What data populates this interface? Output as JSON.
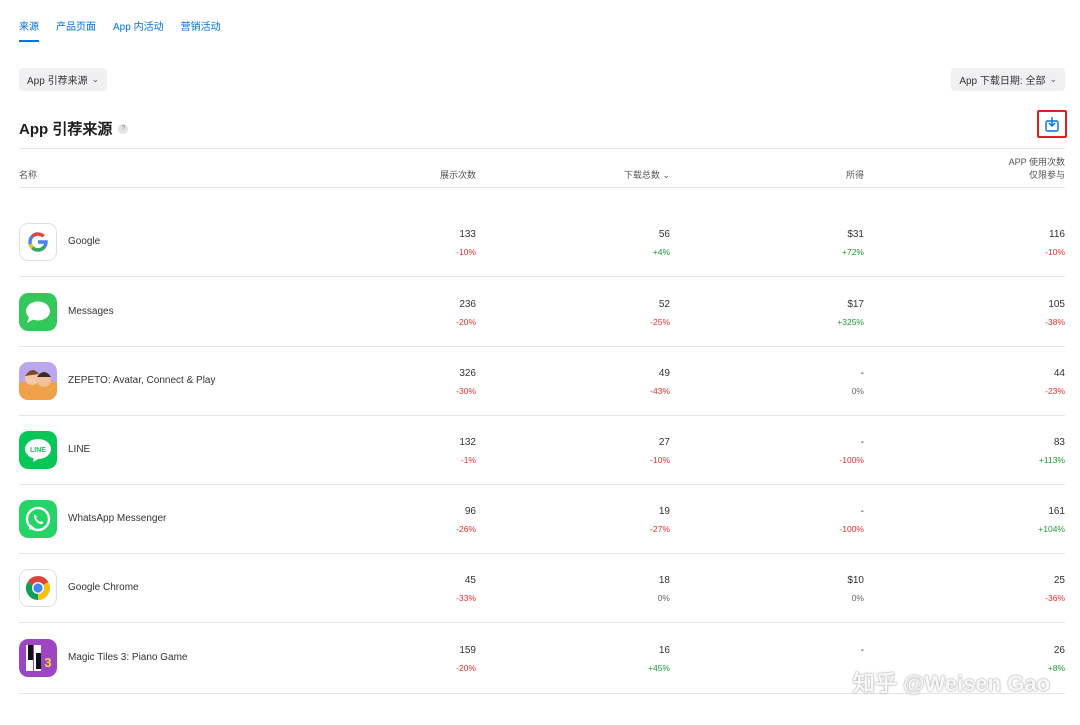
{
  "tabs": [
    "来源",
    "产品页面",
    "App 内活动",
    "营销活动"
  ],
  "filters": {
    "left_label": "App 引荐来源",
    "right_label": "App 下载日期: 全部"
  },
  "section": {
    "title": "App 引荐来源",
    "help": "?"
  },
  "table": {
    "headers": {
      "name": "名称",
      "impressions": "展示次数",
      "downloads": "下载总数",
      "proceeds": "所得",
      "usage_line1": "APP 使用次数",
      "usage_line2": "仅限参与"
    },
    "rows": [
      {
        "name": "Google",
        "icon": "google-icon",
        "impressions": "133",
        "impressions_delta": "-10%",
        "downloads": "56",
        "downloads_delta": "+4%",
        "proceeds": "$31",
        "proceeds_delta": "+72%",
        "usage": "116",
        "usage_delta": "-10%"
      },
      {
        "name": "Messages",
        "icon": "messages-icon",
        "impressions": "236",
        "impressions_delta": "-20%",
        "downloads": "52",
        "downloads_delta": "-25%",
        "proceeds": "$17",
        "proceeds_delta": "+325%",
        "usage": "105",
        "usage_delta": "-38%"
      },
      {
        "name": "ZEPETO: Avatar, Connect & Play",
        "icon": "zepeto-icon",
        "impressions": "326",
        "impressions_delta": "-30%",
        "downloads": "49",
        "downloads_delta": "-43%",
        "proceeds": "-",
        "proceeds_delta": "0%",
        "usage": "44",
        "usage_delta": "-23%"
      },
      {
        "name": "LINE",
        "icon": "line-icon",
        "impressions": "132",
        "impressions_delta": "-1%",
        "downloads": "27",
        "downloads_delta": "-10%",
        "proceeds": "-",
        "proceeds_delta": "-100%",
        "usage": "83",
        "usage_delta": "+113%"
      },
      {
        "name": "WhatsApp Messenger",
        "icon": "whatsapp-icon",
        "impressions": "96",
        "impressions_delta": "-26%",
        "downloads": "19",
        "downloads_delta": "-27%",
        "proceeds": "-",
        "proceeds_delta": "-100%",
        "usage": "161",
        "usage_delta": "+104%"
      },
      {
        "name": "Google Chrome",
        "icon": "chrome-icon",
        "impressions": "45",
        "impressions_delta": "-33%",
        "downloads": "18",
        "downloads_delta": "0%",
        "proceeds": "$10",
        "proceeds_delta": "0%",
        "usage": "25",
        "usage_delta": "-36%"
      },
      {
        "name": "Magic Tiles 3: Piano Game",
        "icon": "magic-tiles-icon",
        "impressions": "159",
        "impressions_delta": "-20%",
        "downloads": "16",
        "downloads_delta": "+45%",
        "proceeds": "-",
        "proceeds_delta": "",
        "usage": "26",
        "usage_delta": "+8%"
      }
    ]
  },
  "watermark": "知乎 @Weisen Gao",
  "colors": {
    "accent": "#0071e3",
    "negative": "#e3302f",
    "positive": "#1f9a34",
    "highlight": "#e02020"
  }
}
